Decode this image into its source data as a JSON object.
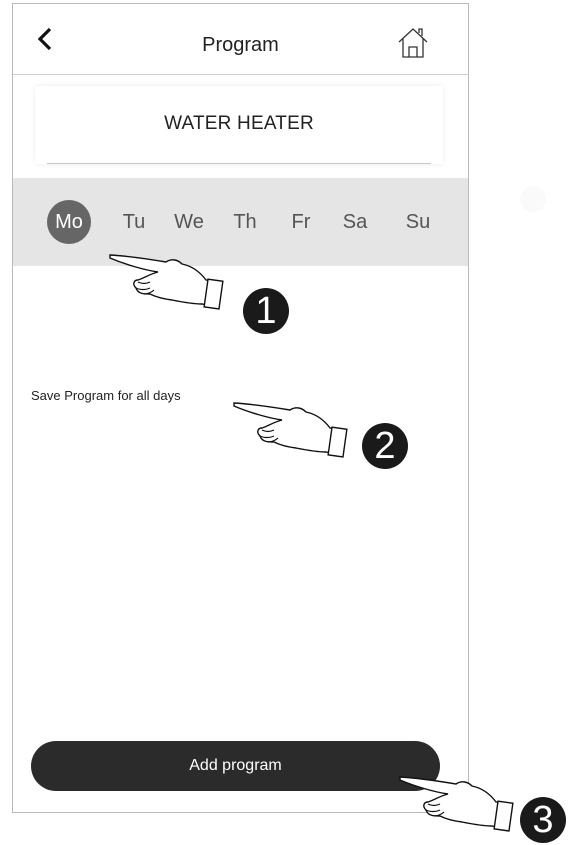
{
  "header": {
    "title": "Program"
  },
  "device": {
    "name": "WATER HEATER"
  },
  "days": [
    {
      "label": "Mo",
      "active": true
    },
    {
      "label": "Tu",
      "active": false
    },
    {
      "label": "We",
      "active": false
    },
    {
      "label": "Th",
      "active": false
    },
    {
      "label": "Fr",
      "active": false
    },
    {
      "label": "Sa",
      "active": false
    },
    {
      "label": "Su",
      "active": false
    }
  ],
  "save_all_label": "Save Program for all days",
  "add_button_label": "Add program",
  "callouts": [
    "1",
    "2",
    "3"
  ],
  "icons": {
    "back": "chevron-left-icon",
    "home": "home-icon",
    "pointer": "pointing-hand-icon"
  },
  "colors": {
    "active_day": "#666666",
    "day_bar": "#e5e5e5",
    "button": "#2b2b2b"
  }
}
